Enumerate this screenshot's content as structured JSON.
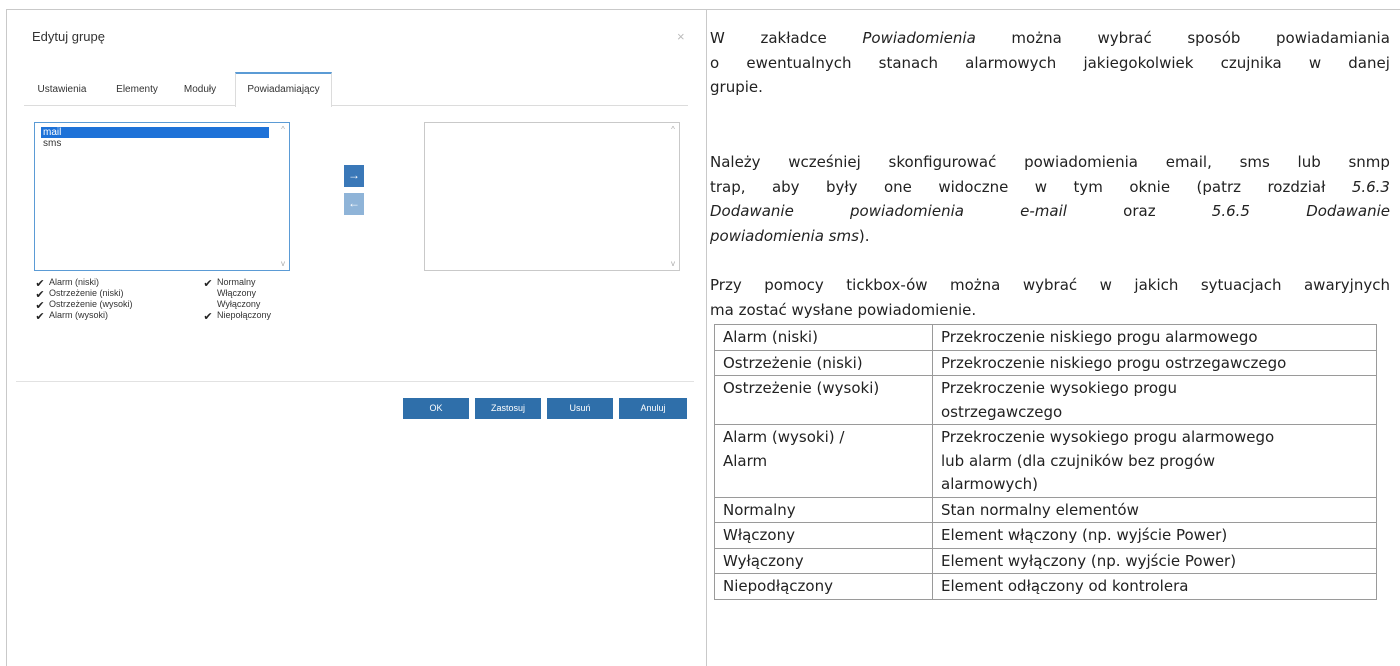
{
  "dialog": {
    "title": "Edytuj grupę",
    "close": "×",
    "tabs": [
      "Ustawienia",
      "Elementy",
      "Moduły",
      "Powiadamiający"
    ],
    "left_list": [
      "mail",
      "sms"
    ],
    "arrow_right": "→",
    "arrow_left": "←",
    "scroll_up": "^",
    "scroll_down": "v",
    "checkboxes_col1": [
      {
        "label": "Alarm (niski)",
        "checked": true
      },
      {
        "label": "Ostrzeżenie (niski)",
        "checked": true
      },
      {
        "label": "Ostrzeżenie (wysoki)",
        "checked": true
      },
      {
        "label": "Alarm (wysoki)",
        "checked": true
      }
    ],
    "checkboxes_col2": [
      {
        "label": "Normalny",
        "checked": true
      },
      {
        "label": "Włączony",
        "checked": false
      },
      {
        "label": "Wyłączony",
        "checked": false
      },
      {
        "label": "Niepołączony",
        "checked": true
      }
    ],
    "buttons": [
      "OK",
      "Zastosuj",
      "Usuń",
      "Anuluj"
    ],
    "colors": {
      "accent": "#2f6faa",
      "selected": "#1e72d8",
      "tab_active": "#5b9bd5"
    }
  },
  "doc": {
    "p1_lines": [
      [
        "W",
        "zakładce",
        "*Powiadomienia*",
        "można",
        "wybrać",
        "sposób",
        "powiadamiania"
      ],
      [
        "o",
        "ewentualnych",
        "stanach",
        "alarmowych",
        "jakiegokolwiek",
        "czujnika",
        "w",
        "danej"
      ],
      [
        "grupie."
      ]
    ],
    "p2_lines": [
      [
        "Należy",
        "wcześniej",
        "skonfigurować",
        "powiadomienia",
        "email,",
        "sms",
        "lub",
        "snmp"
      ],
      [
        "trap,",
        "aby",
        "były",
        "one",
        "widoczne",
        "w",
        "tym",
        "oknie",
        "(patrz",
        "rozdział",
        "*5.6.3*"
      ],
      [
        "*Dodawanie*",
        "*powiadomienia*",
        "*e-mail*",
        "oraz",
        "*5.6.5*",
        "*Dodawanie*"
      ],
      [
        "*powiadomienia sms*)."
      ]
    ],
    "p3_lines": [
      [
        "Przy",
        "pomocy",
        "tickbox-ów",
        "można",
        "wybrać",
        "w",
        "jakich",
        "sytuacjach",
        "awaryjnych"
      ],
      [
        "ma zostać wysłane powiadomienie."
      ]
    ],
    "table": [
      [
        "Alarm (niski)",
        "Przekroczenie niskiego progu alarmowego"
      ],
      [
        "Ostrzeżenie (niski)",
        "Przekroczenie niskiego progu ostrzegawczego"
      ],
      [
        "Ostrzeżenie (wysoki)",
        "Przekroczenie wysokiego progu\nostrzegawczego"
      ],
      [
        "Alarm (wysoki) /\nAlarm",
        "Przekroczenie wysokiego progu alarmowego\nlub alarm (dla czujników bez progów\nalarmowych)"
      ],
      [
        "Normalny",
        "Stan normalny elementów"
      ],
      [
        "Włączony",
        "Element włączony (np. wyjście Power)"
      ],
      [
        "Wyłączony",
        "Element wyłączony (np. wyjście Power)"
      ],
      [
        "Niepodłączony",
        "Element odłączony od kontrolera"
      ]
    ]
  }
}
